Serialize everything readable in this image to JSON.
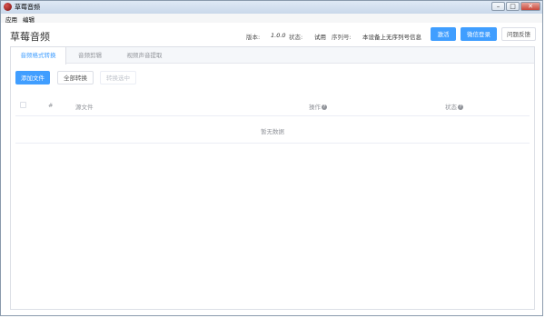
{
  "window": {
    "title": "草莓音频",
    "buttons": {
      "minimize": "–",
      "maximize": "□",
      "close": "✕"
    }
  },
  "menu": [
    "应用",
    "编辑"
  ],
  "header": {
    "app_title": "草莓音频",
    "version_label": "版本:",
    "version_value": "1.0.0",
    "status_label": "状态:",
    "status_value": "试用",
    "serial_label": "序列号:",
    "serial_value": "本设备上无序列号信息",
    "btn_register": "激活",
    "btn_wechat": "微信登录",
    "btn_feedback": "问题反馈"
  },
  "tabs": [
    {
      "label": "音频格式转换",
      "active": true
    },
    {
      "label": "音频剪辑",
      "active": false
    },
    {
      "label": "视频声音提取",
      "active": false
    }
  ],
  "toolbar": {
    "add_files": "添加文件",
    "convert_all": "全部转换",
    "clear_list": "转换选中"
  },
  "table": {
    "columns": [
      "#",
      "源文件",
      "操作",
      "状态"
    ],
    "help_icon": "?",
    "empty_text": "暂无数据"
  },
  "colors": {
    "primary": "#409eff",
    "border": "#dcdfe6",
    "muted": "#909399"
  }
}
